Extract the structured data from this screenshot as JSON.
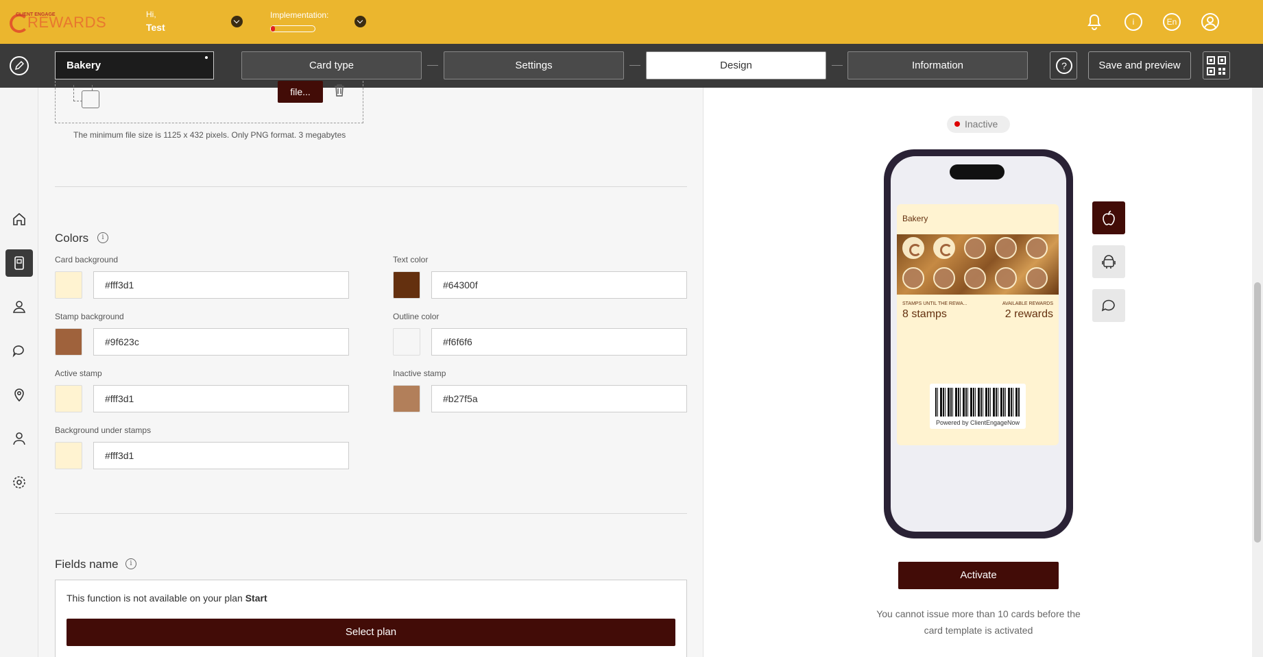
{
  "header": {
    "logo_text": "REWARDS",
    "logo_small": "CLIENT ENGAGE",
    "greeting": "Hi,",
    "user_name": "Test",
    "implementation_label": "Implementation:",
    "implementation_progress": 0.1,
    "language": "En"
  },
  "steps": {
    "template_name": "Bakery",
    "items": [
      "Card type",
      "Settings",
      "Design",
      "Information"
    ],
    "active": "Design",
    "save_label": "Save and preview"
  },
  "sidebar": {
    "items": [
      "home-icon",
      "card-icon",
      "users-icon",
      "chat-icon",
      "location-icon",
      "profile-icon",
      "settings-icon"
    ],
    "active": "card-icon"
  },
  "upload": {
    "file_button": "file...",
    "hint": "The minimum file size is 1125 x 432 pixels. Only PNG format. 3 megabytes"
  },
  "colors": {
    "title": "Colors",
    "card_background": {
      "label": "Card background",
      "value": "#fff3d1"
    },
    "text_color": {
      "label": "Text color",
      "value": "#64300f"
    },
    "stamp_background": {
      "label": "Stamp background",
      "value": "#9f623c"
    },
    "outline_color": {
      "label": "Outline color",
      "value": "#f6f6f6"
    },
    "active_stamp": {
      "label": "Active stamp",
      "value": "#fff3d1"
    },
    "inactive_stamp": {
      "label": "Inactive stamp",
      "value": "#b27f5a"
    },
    "background_under_stamps": {
      "label": "Background under stamps",
      "value": "#fff3d1"
    }
  },
  "fields_name": {
    "title": "Fields name",
    "plan_text": "This function is not available on your plan",
    "plan_name": "Start",
    "select_plan": "Select plan"
  },
  "preview": {
    "status": "Inactive",
    "card_title": "Bakery",
    "stamps_label": "STAMPS UNTIL THE REWA...",
    "stamps_value": "8 stamps",
    "rewards_label": "AVAILABLE REWARDS",
    "rewards_value": "2 rewards",
    "powered_by": "Powered by ClientEngageNow",
    "activate": "Activate",
    "warning": "You cannot issue more than 10 cards before the card template is activated",
    "os_buttons": [
      "apple-icon",
      "android-icon",
      "message-icon"
    ],
    "active_stamps": 2,
    "total_stamps": 10
  },
  "accent": "#420c07",
  "topbar_color": "#ebb62e"
}
